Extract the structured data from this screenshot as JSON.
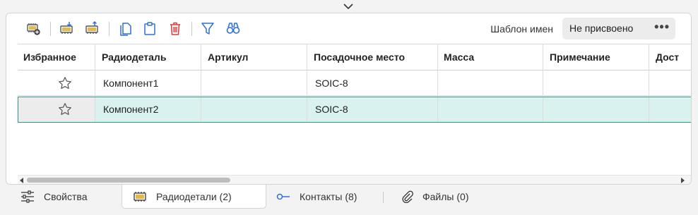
{
  "toolbar": {
    "template_label": "Шаблон имен",
    "template_value": "Не присвоено",
    "more_label": "•••",
    "icons": [
      "add-part-icon",
      "import-part-icon",
      "export-part-icon",
      "copy-icon",
      "paste-icon",
      "delete-icon",
      "filter-icon",
      "find-icon"
    ],
    "accent": "#2f6fd6",
    "danger": "#d23c3c"
  },
  "table": {
    "columns": [
      "Избранное",
      "Радиодеталь",
      "Артикул",
      "Посадочное место",
      "Масса",
      "Примечание",
      "Дост"
    ],
    "rows": [
      {
        "favorite": false,
        "part": "Компонент1",
        "article": "",
        "footprint": "SOIC-8",
        "mass": "",
        "note": "",
        "extra": "",
        "selected": false
      },
      {
        "favorite": false,
        "part": "Компонент2",
        "article": "",
        "footprint": "SOIC-8",
        "mass": "",
        "note": "",
        "extra": "",
        "selected": true
      }
    ],
    "selected_color": "#d9f1ef"
  },
  "tabs": [
    {
      "label": "Свойства",
      "icon": "properties-icon",
      "active": false
    },
    {
      "label": "Радиодетали (2)",
      "icon": "chip-icon",
      "active": true
    },
    {
      "label": "Контакты (8)",
      "icon": "pin-icon",
      "active": false
    },
    {
      "label": "Файлы (0)",
      "icon": "paperclip-icon",
      "active": false
    }
  ]
}
